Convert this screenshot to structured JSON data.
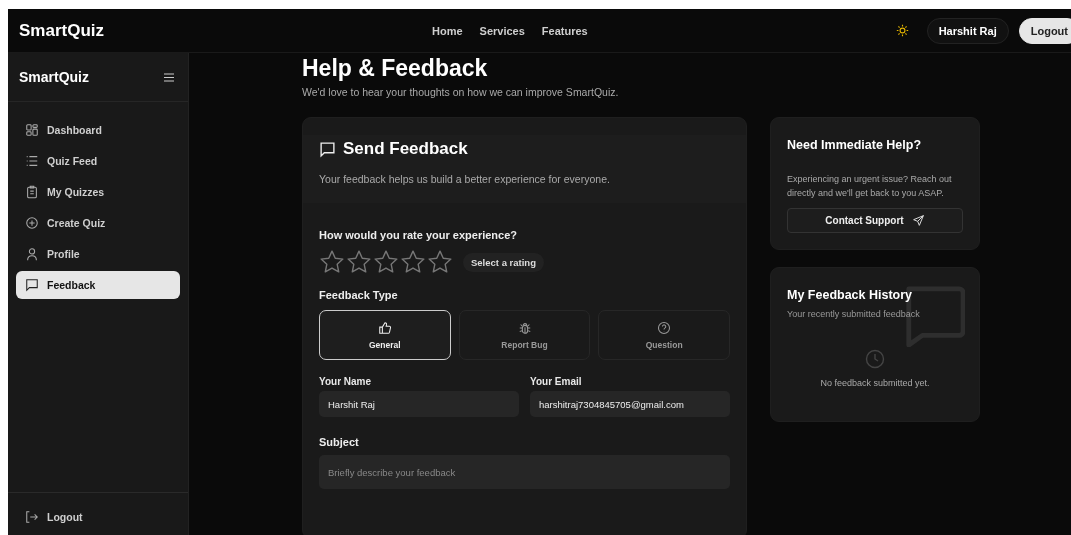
{
  "topbar": {
    "brand": "SmartQuiz",
    "nav": [
      "Home",
      "Services",
      "Features"
    ],
    "user": "Harshit Raj",
    "logout": "Logout"
  },
  "sidebar": {
    "brand": "SmartQuiz",
    "items": [
      {
        "label": "Dashboard",
        "kind": "grid",
        "selected": false
      },
      {
        "label": "Quiz Feed",
        "kind": "list",
        "selected": false
      },
      {
        "label": "My Quizzes",
        "kind": "clipboard",
        "selected": false
      },
      {
        "label": "Create Quiz",
        "kind": "plus",
        "selected": false
      },
      {
        "label": "Profile",
        "kind": "user",
        "selected": false
      },
      {
        "label": "Feedback",
        "kind": "chat",
        "selected": true
      }
    ],
    "logout": "Logout"
  },
  "page": {
    "title": "Help & Feedback",
    "subtitle": "We'd love to hear your thoughts on how we can improve SmartQuiz."
  },
  "feedback_form": {
    "title": "Send Feedback",
    "description": "Your feedback helps us build a better experience for everyone.",
    "rating_label": "How would you rate your experience?",
    "stars": 0,
    "rating_hint": "Select a rating",
    "type_label": "Feedback Type",
    "types": [
      {
        "label": "General",
        "kind": "thumb",
        "selected": true
      },
      {
        "label": "Report Bug",
        "kind": "bug",
        "selected": false
      },
      {
        "label": "Question",
        "kind": "question",
        "selected": false
      }
    ],
    "name_label": "Your Name",
    "name_value": "Harshit Raj",
    "email_label": "Your Email",
    "email_value": "harshitraj7304845705@gmail.com",
    "subject_label": "Subject",
    "subject_placeholder": "Briefly describe your feedback"
  },
  "help_card": {
    "title": "Need Immediate Help?",
    "text": "Experiencing an urgent issue? Reach out directly and we'll get back to you ASAP.",
    "button": "Contact Support"
  },
  "history_card": {
    "title": "My Feedback History",
    "subtitle": "Your recently submitted feedback",
    "empty": "No feedback submitted yet."
  }
}
